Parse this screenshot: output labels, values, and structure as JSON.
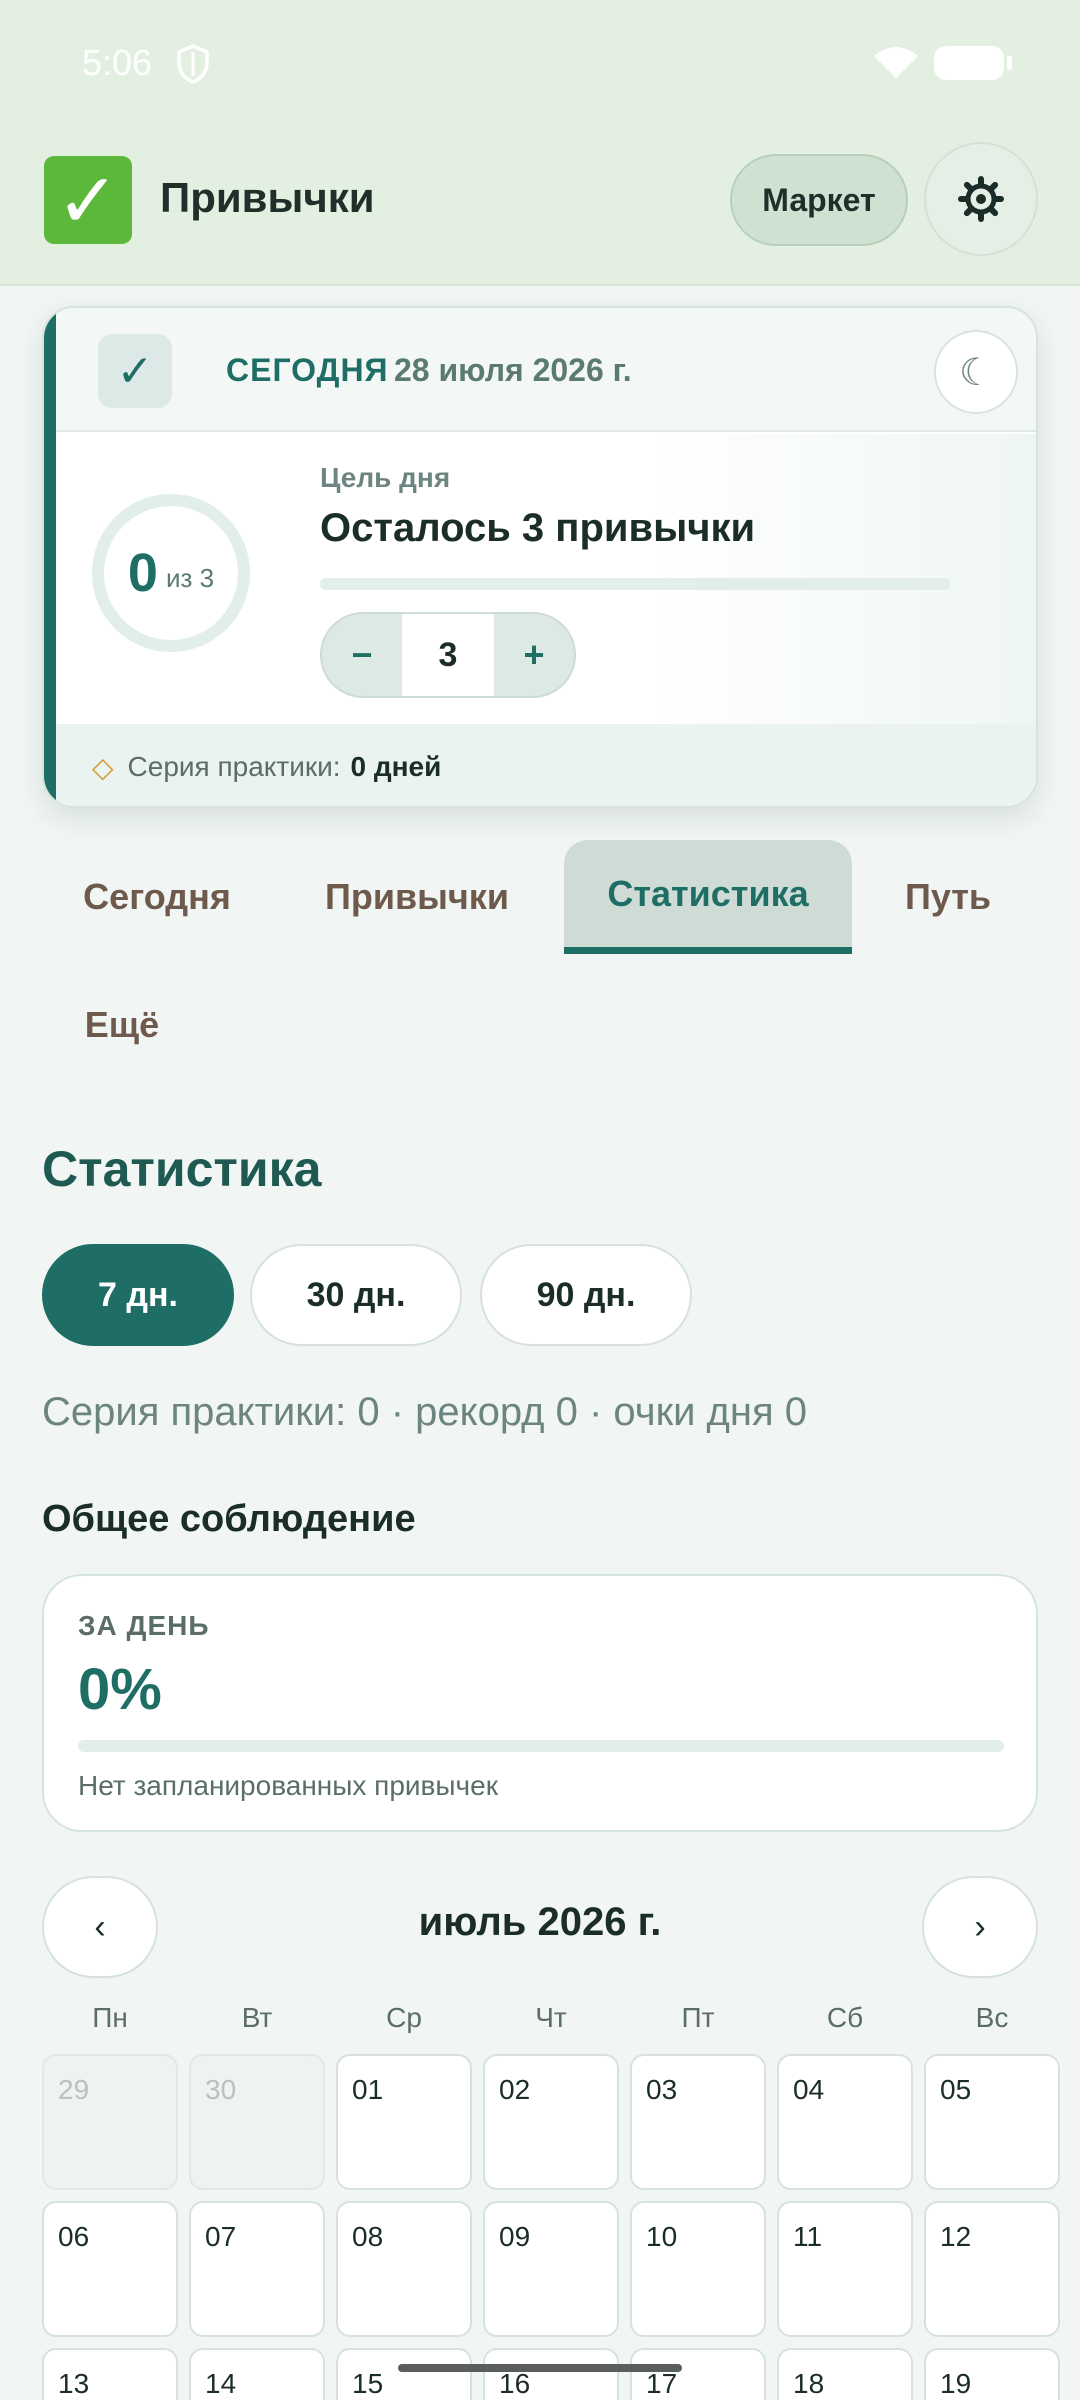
{
  "status_bar": {
    "time": "5:06",
    "icons": [
      "shield-icon",
      "wifi-icon",
      "battery-icon"
    ]
  },
  "header": {
    "logo_icon": "check-mark-button-icon",
    "title": "Привычки",
    "market_label": "Маркет",
    "settings_icon": "gear-icon"
  },
  "today_card": {
    "check_icon": "check-icon",
    "label": "СЕГОДНЯ",
    "date": "28 июля 2026 г.",
    "theme_icon": "moon-icon",
    "progress_done": "0",
    "progress_of": "из 3",
    "goal_label": "Цель дня",
    "goal_title": "Осталось 3 привычки",
    "goal_progress": 0,
    "stepper": {
      "minus": "−",
      "value": "3",
      "plus": "+"
    },
    "streak_icon": "diamond-icon",
    "streak_label": "Серия практики:",
    "streak_value": "0 дней"
  },
  "tabs": [
    {
      "label": "Сегодня",
      "active": false
    },
    {
      "label": "Привычки",
      "active": false
    },
    {
      "label": "Статистика",
      "active": true
    },
    {
      "label": "Путь",
      "active": false
    },
    {
      "label": "Ещё",
      "active": false
    }
  ],
  "stats": {
    "title": "Статистика",
    "periods": [
      {
        "label": "7 дн.",
        "active": true
      },
      {
        "label": "30 дн.",
        "active": false
      },
      {
        "label": "90 дн.",
        "active": false
      }
    ],
    "summary": "Серия практики: 0 · рекорд 0 · очки дня 0",
    "adherence_title": "Общее соблюдение",
    "adherence": {
      "label": "ЗА ДЕНЬ",
      "percent": "0%",
      "progress": 0,
      "note": "Нет запланированных привычек"
    }
  },
  "calendar": {
    "prev": "‹",
    "next": "›",
    "month": "июль 2026 г.",
    "weekdays": [
      "Пн",
      "Вт",
      "Ср",
      "Чт",
      "Пт",
      "Сб",
      "Вс"
    ],
    "days": [
      {
        "d": "29",
        "muted": true
      },
      {
        "d": "30",
        "muted": true
      },
      {
        "d": "01"
      },
      {
        "d": "02"
      },
      {
        "d": "03"
      },
      {
        "d": "04"
      },
      {
        "d": "05"
      },
      {
        "d": "06"
      },
      {
        "d": "07"
      },
      {
        "d": "08"
      },
      {
        "d": "09"
      },
      {
        "d": "10"
      },
      {
        "d": "11"
      },
      {
        "d": "12"
      },
      {
        "d": "13"
      },
      {
        "d": "14"
      },
      {
        "d": "15"
      },
      {
        "d": "16"
      },
      {
        "d": "17"
      },
      {
        "d": "18"
      },
      {
        "d": "19"
      }
    ]
  },
  "colors": {
    "accent": "#1e6e66",
    "header_bg": "#e3f0e1",
    "page_bg": "#f1f5f3",
    "streak": "#d49a34"
  }
}
